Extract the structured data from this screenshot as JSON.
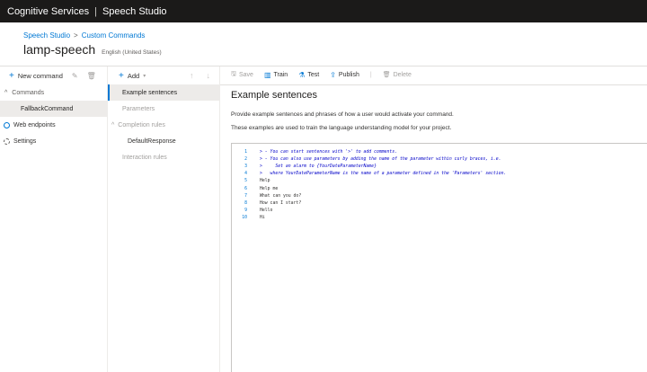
{
  "topbar": {
    "brand": "Cognitive Services",
    "product": "Speech Studio"
  },
  "breadcrumb": {
    "first": "Speech Studio",
    "second": "Custom Commands"
  },
  "project": {
    "name": "lamp-speech",
    "locale": "English (United States)"
  },
  "left": {
    "new_command": "New command",
    "commands_label": "Commands",
    "selected_command": "FallbackCommand",
    "web_endpoints": "Web endpoints",
    "settings": "Settings"
  },
  "mid": {
    "add": "Add",
    "items": {
      "example_sentences": "Example sentences",
      "parameters": "Parameters",
      "completion_rules": "Completion rules",
      "default_response": "DefaultResponse",
      "interaction_rules": "Interaction rules"
    }
  },
  "toolbar": {
    "save": "Save",
    "train": "Train",
    "test": "Test",
    "publish": "Publish",
    "delete": "Delete"
  },
  "content": {
    "title": "Example sentences",
    "desc1": "Provide example sentences and phrases of how a user would activate your command.",
    "desc2": "These examples are used to train the language understanding model for your project."
  },
  "editor": {
    "lines": [
      {
        "n": "1",
        "text": "> - You can start sentences with '>' to add comments.",
        "comment": true
      },
      {
        "n": "2",
        "text": "> - You can also use parameters by adding the name of the parameter within curly braces, i.e.",
        "comment": true
      },
      {
        "n": "3",
        "text": ">     Set an alarm to {YourDateParameterName}",
        "comment": true
      },
      {
        "n": "4",
        "text": ">   where YourDateParameterName is the name of a parameter defined in the 'Parameters' section.",
        "comment": true
      },
      {
        "n": "5",
        "text": "Help",
        "comment": false
      },
      {
        "n": "6",
        "text": "Help me",
        "comment": false
      },
      {
        "n": "7",
        "text": "What can you do?",
        "comment": false
      },
      {
        "n": "8",
        "text": "How can I start?",
        "comment": false
      },
      {
        "n": "9",
        "text": "Hello",
        "comment": false
      },
      {
        "n": "10",
        "text": "Hi",
        "comment": false
      }
    ]
  },
  "colors": {
    "accent": "#0078d4",
    "topbar": "#1b1a19",
    "selected": "#edebe9"
  }
}
